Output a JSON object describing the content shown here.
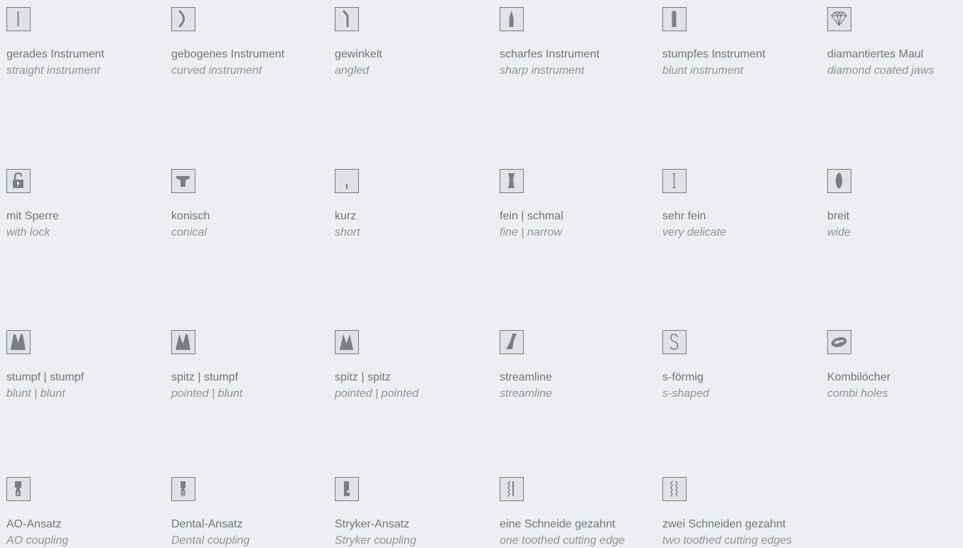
{
  "items": [
    {
      "icon": "straight-instrument-icon",
      "de": "gerades Instrument",
      "en": "straight instrument"
    },
    {
      "icon": "curved-instrument-icon",
      "de": "gebogenes Instrument",
      "en": "curved instrument"
    },
    {
      "icon": "angled-icon",
      "de": "gewinkelt",
      "en": "angled"
    },
    {
      "icon": "sharp-instrument-icon",
      "de": "scharfes Instrument",
      "en": "sharp instrument"
    },
    {
      "icon": "blunt-instrument-icon",
      "de": "stumpfes Instrument",
      "en": "blunt instrument"
    },
    {
      "icon": "diamond-icon",
      "de": "diamantiertes Maul",
      "en": "diamond coated jaws"
    },
    {
      "icon": "lock-icon",
      "de": "mit Sperre",
      "en": "with lock"
    },
    {
      "icon": "conical-icon",
      "de": "konisch",
      "en": "conical"
    },
    {
      "icon": "short-icon",
      "de": "kurz",
      "en": "short"
    },
    {
      "icon": "fine-narrow-icon",
      "de": "fein | schmal",
      "en": "fine | narrow"
    },
    {
      "icon": "very-delicate-icon",
      "de": "sehr fein",
      "en": "very delicate"
    },
    {
      "icon": "wide-icon",
      "de": "breit",
      "en": "wide"
    },
    {
      "icon": "blunt-blunt-icon",
      "de": "stumpf | stumpf",
      "en": "blunt | blunt"
    },
    {
      "icon": "pointed-blunt-icon",
      "de": "spitz | stumpf",
      "en": "pointed | blunt"
    },
    {
      "icon": "pointed-pointed-icon",
      "de": "spitz | spitz",
      "en": "pointed | pointed"
    },
    {
      "icon": "streamline-icon",
      "de": "streamline",
      "en": "streamline"
    },
    {
      "icon": "s-shaped-icon",
      "de": "s-förmig",
      "en": "s-shaped"
    },
    {
      "icon": "combi-holes-icon",
      "de": "Kombilöcher",
      "en": "combi holes"
    },
    {
      "icon": "ao-coupling-icon",
      "de": "AO-Ansatz",
      "en": "AO coupling"
    },
    {
      "icon": "dental-coupling-icon",
      "de": "Dental-Ansatz",
      "en": "Dental coupling"
    },
    {
      "icon": "stryker-coupling-icon",
      "de": "Stryker-Ansatz",
      "en": "Stryker coupling"
    },
    {
      "icon": "one-toothed-edge-icon",
      "de": "eine Schneide gezahnt",
      "en": "one toothed cutting edge"
    },
    {
      "icon": "two-toothed-edges-icon",
      "de": "zwei Schneiden gezahnt",
      "en": "two toothed cutting edges"
    }
  ]
}
